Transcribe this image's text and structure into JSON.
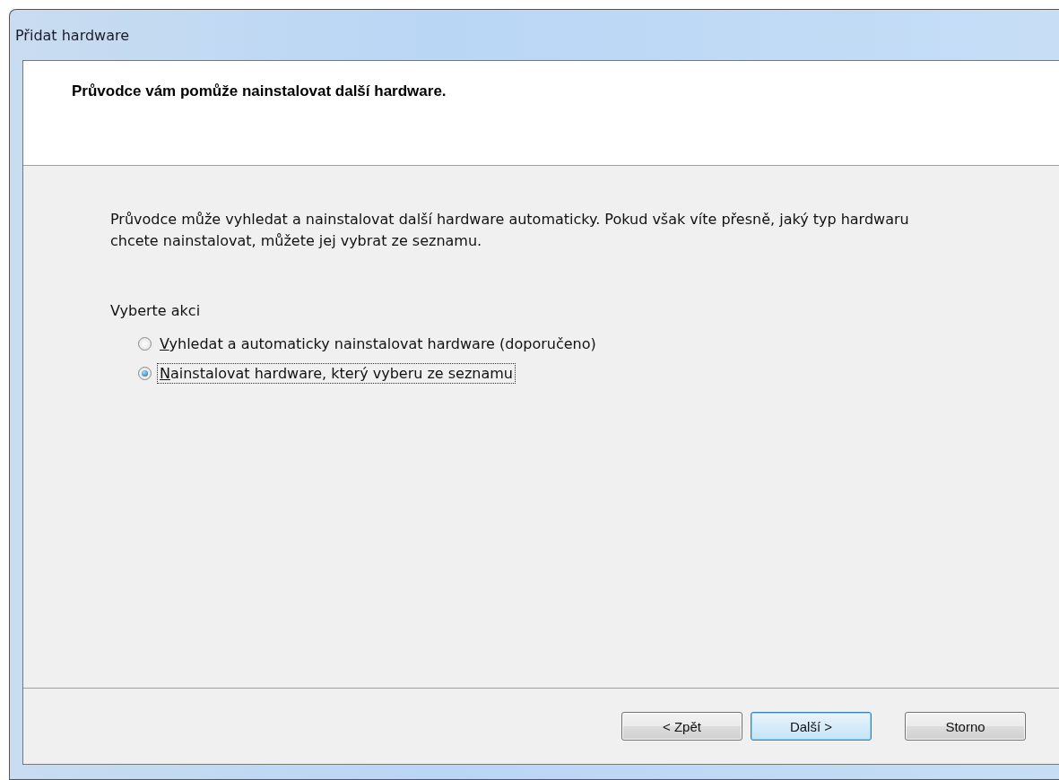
{
  "window": {
    "title": "Přidat hardware"
  },
  "header": {
    "title": "Průvodce vám pomůže nainstalovat další hardware."
  },
  "intro": "Průvodce může vyhledat a nainstalovat další hardware automaticky. Pokud však víte přesně, jaký typ hardwaru chcete nainstalovat, můžete jej vybrat ze seznamu.",
  "action_group": {
    "label": "Vyberte akci",
    "options": [
      {
        "label": "Vyhledat a automaticky nainstalovat hardware (doporučeno)",
        "selected": false
      },
      {
        "label": "Nainstalovat hardware, který vyberu ze seznamu",
        "selected": true
      }
    ]
  },
  "buttons": [
    {
      "label": "< Zpět",
      "default": false
    },
    {
      "label": "Další >",
      "default": true
    },
    {
      "label": "Storno",
      "default": false
    }
  ]
}
